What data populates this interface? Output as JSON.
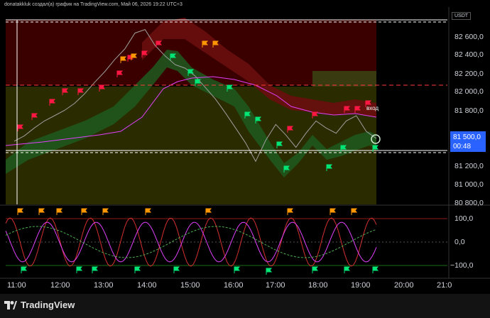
{
  "header": {
    "text": "donatakkluk создал(а) график на TradingView.com, Май 06, 2026 19:22 UTC+3"
  },
  "price_axis": {
    "currency": "USDT",
    "ticks": [
      "82 600,0",
      "82 400,0",
      "82 200,0",
      "82 000,0",
      "81 800,0",
      "81 200,0",
      "81 000,0",
      "80 800,0"
    ],
    "current_price": "81 500,0",
    "countdown": "00:48"
  },
  "oscillator_axis": {
    "ticks": [
      "100,0",
      "0,0",
      "−100,0"
    ]
  },
  "time_axis": {
    "ticks": [
      "11:00",
      "12:00",
      "13:00",
      "14:00",
      "15:00",
      "16:00",
      "17:00",
      "18:00",
      "19:00",
      "20:00",
      "21:0"
    ]
  },
  "annotation": {
    "label": "вход"
  },
  "footer": {
    "brand": "TradingView"
  },
  "colors": {
    "background": "#000000",
    "price_box": "#2962ff",
    "bull_flag": "#00e676",
    "bear_flag": "#ff1744",
    "orange_flag": "#ff9800",
    "band_green": "#2e7d32",
    "band_red": "#7f0000",
    "zone_olive": "#2b2b00",
    "zone_maroon": "#3a0000",
    "dashed_red": "#ff3b3b",
    "magenta": "#e040fb"
  },
  "chart_data": {
    "type": "line",
    "title": "",
    "ylabel": "USDT",
    "ylim": [
      80750,
      82850
    ],
    "x_ticks": [
      "11:00",
      "12:00",
      "13:00",
      "14:00",
      "15:00",
      "16:00",
      "17:00",
      "18:00",
      "19:00",
      "20:00",
      "21:0"
    ],
    "series": [
      {
        "values": [
          81470,
          81530,
          81620,
          81700,
          81760,
          81820,
          81900,
          82010,
          82140,
          82260,
          82400,
          82520,
          82700,
          82740,
          82560,
          82440,
          82340,
          82300,
          82210,
          82080,
          81950,
          81790,
          81620,
          81450,
          81240,
          81480,
          81660,
          81540,
          81400,
          81560,
          81700,
          81620,
          81560,
          81700,
          81760,
          81580,
          81500
        ]
      }
    ],
    "oscillator": {
      "ylim": [
        -110,
        110
      ],
      "ticks": [
        100,
        0,
        -100
      ]
    },
    "grid": false,
    "legend": "none"
  }
}
